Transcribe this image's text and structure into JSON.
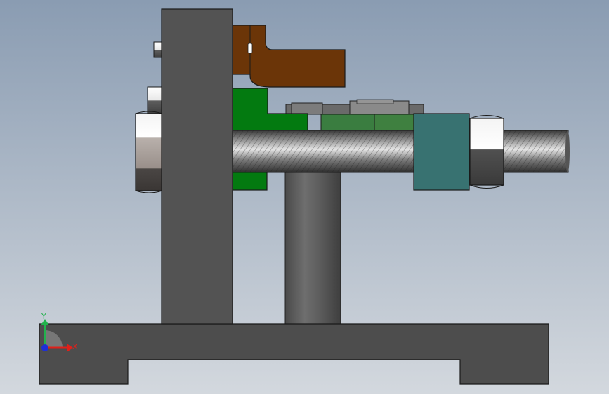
{
  "view": {
    "background_top": "#8a9cb2",
    "background_bottom": "#d3d8de"
  },
  "triad": {
    "y_label": "Y",
    "x_label": "X",
    "y_color": "#22b14c",
    "x_color": "#e0201a",
    "z_color": "#1f2fd6"
  },
  "parts": {
    "base_color": "#4d4d4d",
    "upright_color": "#535353",
    "bracket_color": "#6b3508",
    "clamp_color": "#037a10",
    "jaw_color": "#3a7d40",
    "collar_color": "#387271",
    "post_color": "#5b5b5b",
    "nut_color": "#4e4a48",
    "screw_color": "#6b6b6b"
  }
}
